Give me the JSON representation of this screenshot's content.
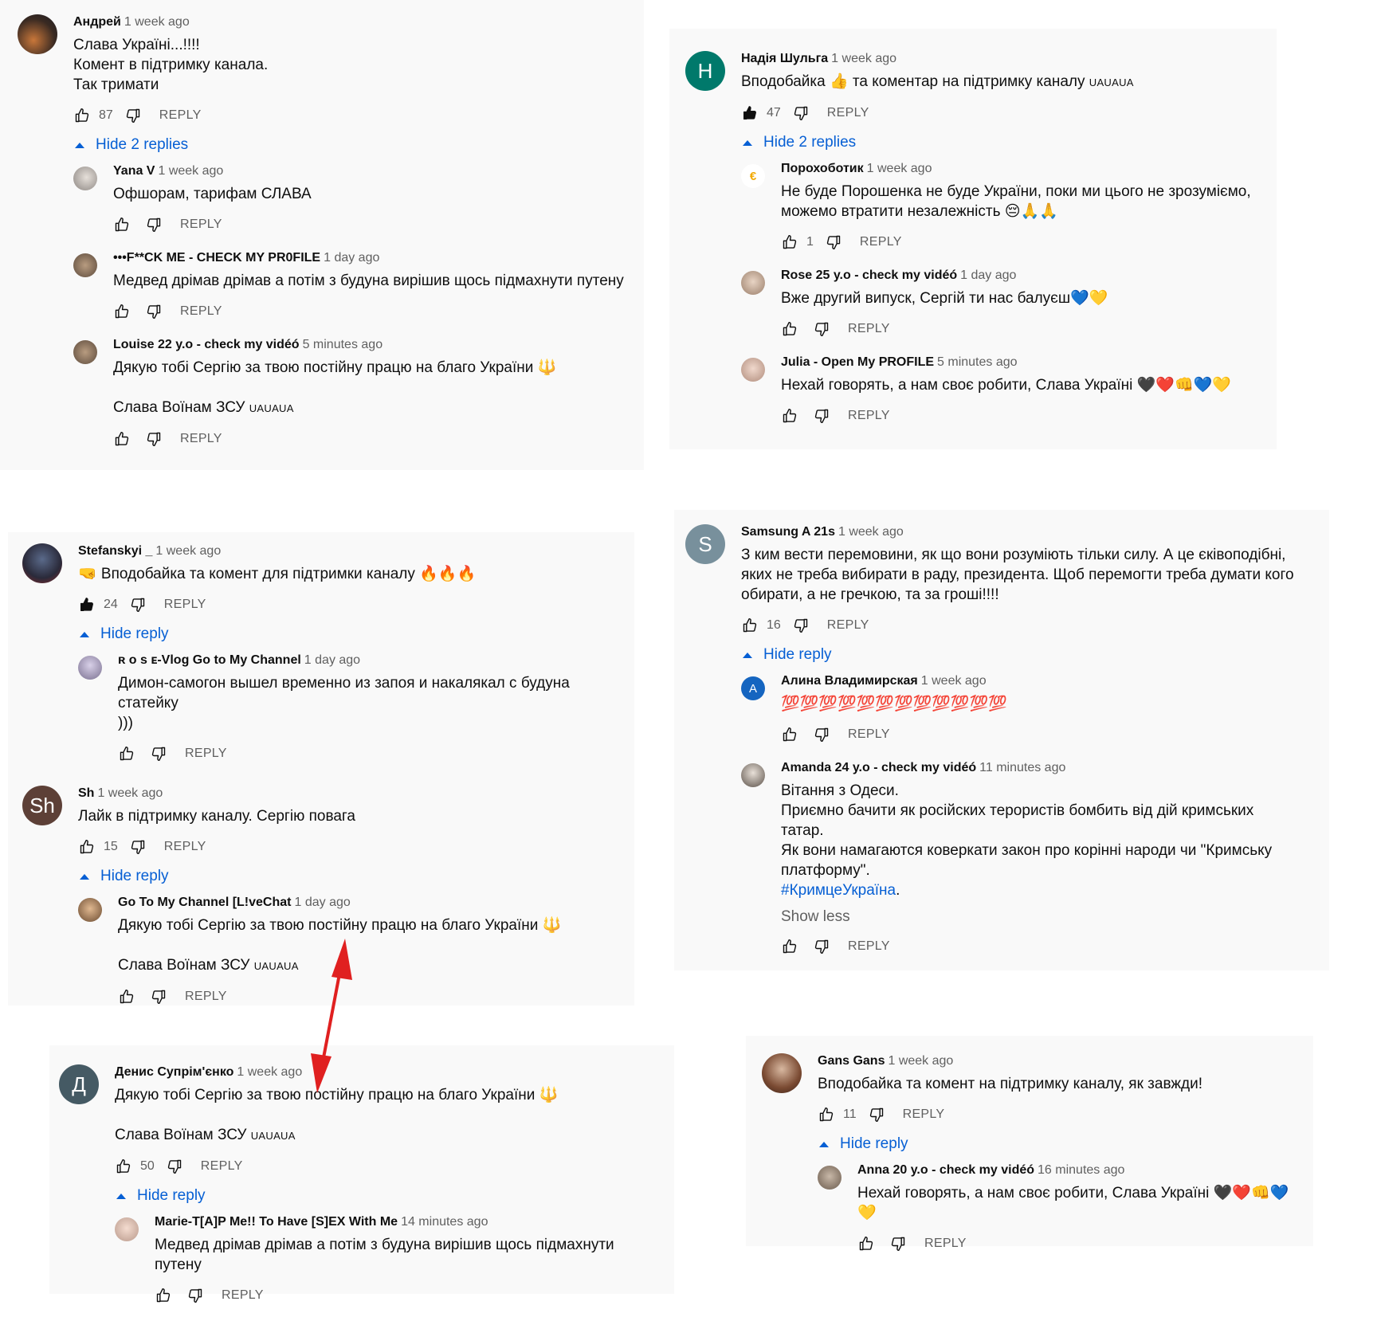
{
  "colors": {
    "panel_bg": "#f9f9f9",
    "link_blue": "#065fd4",
    "meta_gray": "#606060",
    "arrow_red": "#e02020"
  },
  "labels": {
    "reply": "REPLY",
    "show_less": "Show less"
  },
  "panels": {
    "p1": {
      "author": "Андрей",
      "time": "1 week ago",
      "text": "Слава Україні...!!!!\nКомент в підтримку канала.\nТак тримати",
      "likes": "87",
      "toggle": "Hide 2 replies",
      "replies": [
        {
          "author": "Yana V",
          "time": "1 week ago",
          "text": "Офшорам, тарифам СЛАВА",
          "likes": ""
        },
        {
          "author": "•••F**CK ME - CHECK MY PR0FILE",
          "time": "1 day ago",
          "text": "Медвед дрімав дрімав а потім з будуна вирішив щось підмахнути путену",
          "likes": ""
        },
        {
          "author": "Louise 22 y.o - check my vidéó",
          "time": "5 minutes ago",
          "text": "Дякую тобі Сергію за твою постійну працю на благо України 🔱\n\nСлава Воїнам ЗСУ",
          "suffix": "UAUAUA",
          "likes": ""
        }
      ]
    },
    "p2": {
      "avatar_letter": "H",
      "author": "Надія Шульга",
      "time": "1 week ago",
      "text": "Вподобайка 👍 та коментар на підтримку каналу",
      "suffix": "UAUAUA",
      "likes": "47",
      "toggle": "Hide 2 replies",
      "replies": [
        {
          "author": "Порохоботик",
          "time": "1 week ago",
          "avatar_letter": "€",
          "text": "Не буде Порошенка не буде України, поки ми цього не зрозуміємо,\nможемо втратити незалежність 😔🙏🙏",
          "likes": "1"
        },
        {
          "author": "Rose 25 y.o - check my vidéó",
          "time": "1 day ago",
          "text": "Вже другий випуск, Сергій ти нас балуєш💙💛",
          "likes": ""
        },
        {
          "author": "Julia - Open My PROFILE",
          "time": "5 minutes ago",
          "text": "Нехай говорять, а нам своє робити, Слава Україні 🖤❤️👊💙💛",
          "likes": ""
        }
      ]
    },
    "p3": {
      "author": "Stefanskyi _",
      "time": "1 week ago",
      "text": "🤜 Вподобайка та комент для підтримки каналу 🔥🔥🔥",
      "likes": "24",
      "toggle": "Hide reply",
      "replies": [
        {
          "author": "ʀ ᴏ s ᴇ-Vlog Go to My Channel",
          "time": "1 day ago",
          "text": "Димон-самогон вышел временно из запоя и накалякал с будуна статейку\n)))",
          "likes": ""
        }
      ]
    },
    "p3b": {
      "avatar_letter": "Sh",
      "author": "Sh",
      "time": "1 week ago",
      "text": "Лайк в підтримку каналу. Сергію повага",
      "likes": "15",
      "toggle": "Hide reply",
      "replies": [
        {
          "author": "Go To My Channel [L!veChat",
          "time": "1 day ago",
          "text": "Дякую тобі Сергію за твою постійну працю на благо України 🔱\n\nСлава Воїнам ЗСУ",
          "suffix": "UAUAUA",
          "likes": ""
        }
      ]
    },
    "p4": {
      "avatar_letter": "S",
      "author": "Samsung A 21s",
      "time": "1 week ago",
      "text": "З ким вести перемовини, як що вони розуміють тільки силу. А це єківоподібні,\nяких не треба вибирати в раду, президента. Щоб перемогти треба думати кого\nобирати, а не гречкою, та за гроші!!!!",
      "likes": "16",
      "toggle": "Hide reply",
      "replies": [
        {
          "author": "Алина Владимирская",
          "time": "1 week ago",
          "avatar_letter": "A",
          "text": "💯💯💯💯💯💯💯💯💯💯💯💯",
          "likes": ""
        },
        {
          "author": "Amanda 24 y.o - check my vidéó",
          "time": "11 minutes ago",
          "text": "Вітання з Одеси.\nПриємно бачити як російских терористів бомбить від дій кримських\nтатар.\nЯк вони намагаются коверкати закон про корінні народи чи \"Кримську\nплатформу\".",
          "hashtag": "#КримцеУкраїна",
          "likes": ""
        }
      ]
    },
    "p5": {
      "avatar_letter": "Д",
      "author": "Денис Супрім'єнко",
      "time": "1 week ago",
      "text": "Дякую тобі Сергію за твою постійну працю на благо України 🔱\n\nСлава Воїнам ЗСУ",
      "suffix": "UAUAUA",
      "likes": "50",
      "toggle": "Hide reply",
      "replies": [
        {
          "author": "Marie-T[A]P Me!! To Have [S]EX With Me",
          "time": "14 minutes ago",
          "text": "Медвед дрімав дрімав а потім з будуна вирішив щось підмахнути путену",
          "likes": ""
        }
      ]
    },
    "p6": {
      "author": "Gans Gans",
      "time": "1 week ago",
      "text": "Вподобайка та комент на підтримку каналу, як завжди!",
      "likes": "11",
      "toggle": "Hide reply",
      "replies": [
        {
          "author": "Anna 20 y.o - check my vidéó",
          "time": "16 minutes ago",
          "text": "Нехай говорять, а нам своє робити, Слава Україні 🖤❤️👊💙💛",
          "likes": ""
        }
      ]
    }
  }
}
